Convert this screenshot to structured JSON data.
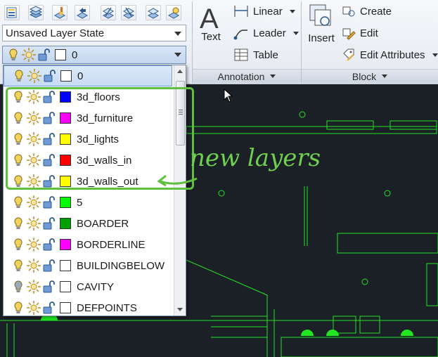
{
  "ribbon": {
    "layer_state": {
      "value": "Unsaved Layer State"
    },
    "current_layer": {
      "name": "0"
    },
    "annotation": {
      "panel_title": "Annotation",
      "text_button": "Text",
      "linear_button": "Linear",
      "leader_button": "Leader",
      "table_button": "Table"
    },
    "block": {
      "panel_title": "Block",
      "insert_button": "Insert",
      "create_button": "Create",
      "edit_button": "Edit",
      "edit_attributes_button": "Edit Attributes"
    }
  },
  "layers": [
    {
      "name": "0",
      "color": "#ffffff"
    },
    {
      "name": "3d_floors",
      "color": "#0000ff"
    },
    {
      "name": "3d_furniture",
      "color": "#ff00ff"
    },
    {
      "name": "3d_lights",
      "color": "#ffff00"
    },
    {
      "name": "3d_walls_in",
      "color": "#ff0000"
    },
    {
      "name": "3d_walls_out",
      "color": "#ffff00"
    },
    {
      "name": "5",
      "color": "#00ff00"
    },
    {
      "name": "BOARDER",
      "color": "#00a000"
    },
    {
      "name": "BORDERLINE",
      "color": "#ff00ff"
    },
    {
      "name": "BUILDINGBELOW",
      "color": "#ffffff"
    },
    {
      "name": "CAVITY",
      "color": "#ffffff"
    },
    {
      "name": "DEFPOINTS",
      "color": "#ffffff"
    }
  ],
  "annotation_note": "new layers",
  "colors": {
    "canvas": "#1b1f26",
    "drawing_lines": "#22e622",
    "annotation_green": "#5fbf3f",
    "bulb_on": "#f2d35c",
    "bulb_off": "#9aa9bd"
  }
}
